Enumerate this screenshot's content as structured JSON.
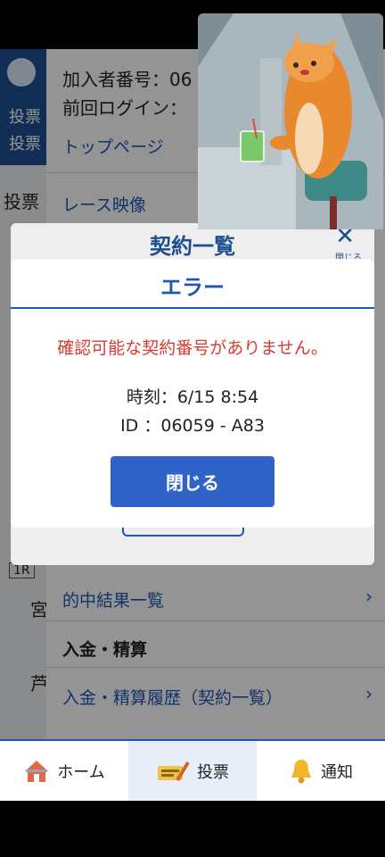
{
  "background": {
    "tabs": [
      "投票",
      "投票"
    ],
    "left_label": "投票",
    "menu": {
      "member_number": "加入者番号：06",
      "last_login": "前回ログイン：",
      "top_page": "トップページ",
      "race_video": "レース映像",
      "hit_results": "的中結果一覧",
      "deposit_section": "入金・精算",
      "deposit_history": "入金・精算履歴（契約一覧）",
      "chevron": "›"
    },
    "side_fragments": [
      "1R",
      "宮",
      "芦"
    ]
  },
  "sheet": {
    "title": "契約一覧",
    "close_icon": "✕",
    "close_label": "閉じる"
  },
  "dialog": {
    "title": "エラー",
    "message": "確認可能な契約番号がありません。",
    "time": "時刻：6/15 8:54",
    "id": "ID ：06059 - A83",
    "close_button": "閉じる"
  },
  "bottom_nav": {
    "items": [
      {
        "label": "ホーム",
        "icon": "home-icon"
      },
      {
        "label": "投票",
        "icon": "ticket-pen-icon",
        "active": true
      },
      {
        "label": "通知",
        "icon": "bell-icon"
      }
    ]
  },
  "colors": {
    "accent": "#1f56b3",
    "error": "#d93a32",
    "header": "#1c4f8f"
  }
}
